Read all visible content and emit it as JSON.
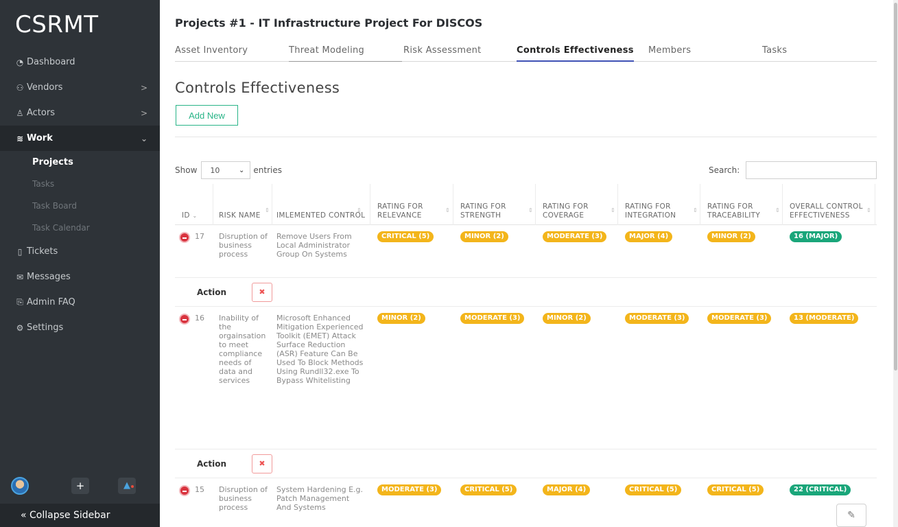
{
  "sidebar": {
    "brand": "CSRMT",
    "items": [
      {
        "icon": "dashboard-icon",
        "label": "Dashboard"
      },
      {
        "icon": "vendors-icon",
        "label": "Vendors",
        "chevron": ">"
      },
      {
        "icon": "actors-icon",
        "label": "Actors",
        "chevron": ">"
      },
      {
        "icon": "work-icon",
        "label": "Work",
        "chevron": "⌄"
      }
    ],
    "sub_items": [
      {
        "label": "Projects"
      },
      {
        "label": "Tasks"
      },
      {
        "label": "Task Board"
      },
      {
        "label": "Task Calendar"
      }
    ],
    "items_after": [
      {
        "icon": "tickets-icon",
        "label": "Tickets"
      },
      {
        "icon": "messages-icon",
        "label": "Messages"
      },
      {
        "icon": "admin-faq-icon",
        "label": "Admin FAQ"
      },
      {
        "icon": "settings-icon",
        "label": "Settings"
      }
    ],
    "collapse_label": "« Collapse Sidebar",
    "plus": "+"
  },
  "header": {
    "title": "Projects #1 - IT Infrastructure Project For DISCOS"
  },
  "tabs": [
    {
      "label": "Asset Inventory"
    },
    {
      "label": "Threat Modeling"
    },
    {
      "label": "Risk Assessment"
    },
    {
      "label": "Controls Effectiveness"
    },
    {
      "label": "Members"
    },
    {
      "label": "Tasks"
    }
  ],
  "section": {
    "title": "Controls Effectiveness",
    "add_label": "Add New"
  },
  "table_controls": {
    "show_label": "Show",
    "entries_value": "10",
    "entries_label": "entries",
    "search_label": "Search:"
  },
  "table": {
    "columns": [
      "ID",
      "RISK NAME",
      "IMLEMENTED CONTROL",
      "RATING FOR RELEVANCE",
      "RATING FOR STRENGTH",
      "RATING FOR COVERAGE",
      "RATING FOR INTEGRATION",
      "RATING FOR TRACEABILITY",
      "OVERALL CONTROL EFFECTIVENESS"
    ],
    "action_label": "Action",
    "action_button": "✖",
    "rows": [
      {
        "id": "17",
        "risk": "Disruption of business process",
        "control": "Remove Users From Local Administrator Group On Systems",
        "relevance": "CRITICAL (5)",
        "strength": "MINOR (2)",
        "coverage": "MODERATE (3)",
        "integration": "MAJOR (4)",
        "traceability": "MINOR (2)",
        "overall": "16 (MAJOR)"
      },
      {
        "id": "16",
        "risk": "Inability of the orgainsation to meet compliance needs of data and services",
        "control": "Microsoft Enhanced Mitigation Experienced Toolkit (EMET) Attack Surface Reduction (ASR) Feature Can Be Used To Block Methods Using Rundll32.exe To Bypass Whitelisting",
        "relevance": "MINOR (2)",
        "strength": "MODERATE (3)",
        "coverage": "MINOR (2)",
        "integration": "MODERATE (3)",
        "traceability": "MODERATE (3)",
        "overall": "13 (MODERATE)"
      },
      {
        "id": "15",
        "risk": "Disruption of business process",
        "control": "System Hardening E.g. Patch Management And Systems",
        "relevance": "MODERATE (3)",
        "strength": "CRITICAL (5)",
        "coverage": "MAJOR (4)",
        "integration": "CRITICAL (5)",
        "traceability": "CRITICAL (5)",
        "overall": "22 (CRITICAL)"
      }
    ]
  }
}
